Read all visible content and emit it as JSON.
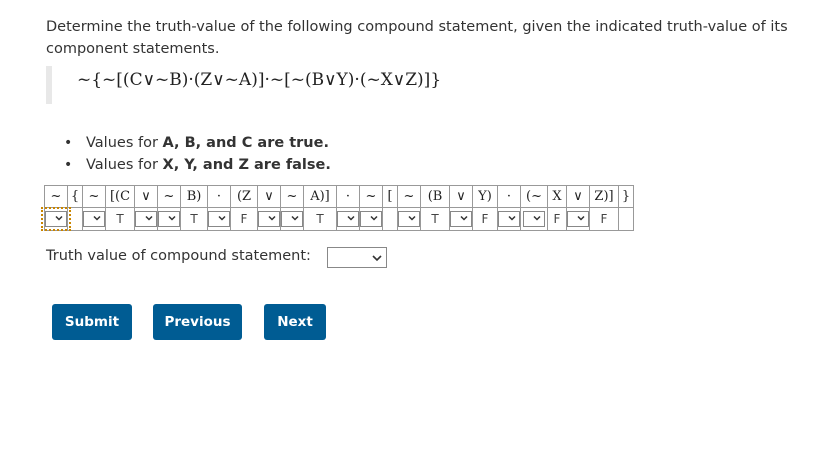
{
  "question": {
    "text": "Determine the truth-value of the following compound statement, given the indicated truth-value of its component statements.",
    "formula": "~{~[(C∨~B)·(Z∨~A)]·~[~(B∨Y)·(~X∨Z)]}"
  },
  "givens": [
    {
      "prefix": "Values for ",
      "bold": "A, B, and C are true."
    },
    {
      "prefix": "Values for ",
      "bold": "X, Y, and Z are false."
    }
  ],
  "table": {
    "symbols": [
      "~",
      "{",
      "~",
      "[(C",
      "∨",
      "~",
      "B)",
      "·",
      "(Z",
      "∨",
      "~",
      "A)]",
      "·",
      "~",
      "[",
      "~",
      "(B",
      "∨",
      "Y)",
      "·",
      "(~",
      "X",
      "∨",
      "Z)]",
      "}"
    ],
    "inputs": [
      {
        "type": "select",
        "value": "",
        "focused": true
      },
      {
        "type": "blank"
      },
      {
        "type": "select",
        "value": ""
      },
      {
        "type": "given",
        "value": "T"
      },
      {
        "type": "select",
        "value": ""
      },
      {
        "type": "select",
        "value": ""
      },
      {
        "type": "given",
        "value": "T"
      },
      {
        "type": "select",
        "value": ""
      },
      {
        "type": "given",
        "value": "F"
      },
      {
        "type": "select",
        "value": ""
      },
      {
        "type": "select",
        "value": ""
      },
      {
        "type": "given",
        "value": "T"
      },
      {
        "type": "select",
        "value": ""
      },
      {
        "type": "select",
        "value": ""
      },
      {
        "type": "blank"
      },
      {
        "type": "select",
        "value": ""
      },
      {
        "type": "given",
        "value": "T"
      },
      {
        "type": "select",
        "value": ""
      },
      {
        "type": "given",
        "value": "F"
      },
      {
        "type": "select",
        "value": ""
      },
      {
        "type": "select",
        "value": ""
      },
      {
        "type": "given",
        "value": "F"
      },
      {
        "type": "select",
        "value": ""
      },
      {
        "type": "given",
        "value": "F"
      },
      {
        "type": "blank"
      }
    ]
  },
  "truth": {
    "label": "Truth value of compound statement:",
    "value": ""
  },
  "buttons": {
    "submit": "Submit",
    "previous": "Previous",
    "next": "Next"
  },
  "colors": {
    "button_bg": "#005c93",
    "focus_outline": "#c98500"
  }
}
